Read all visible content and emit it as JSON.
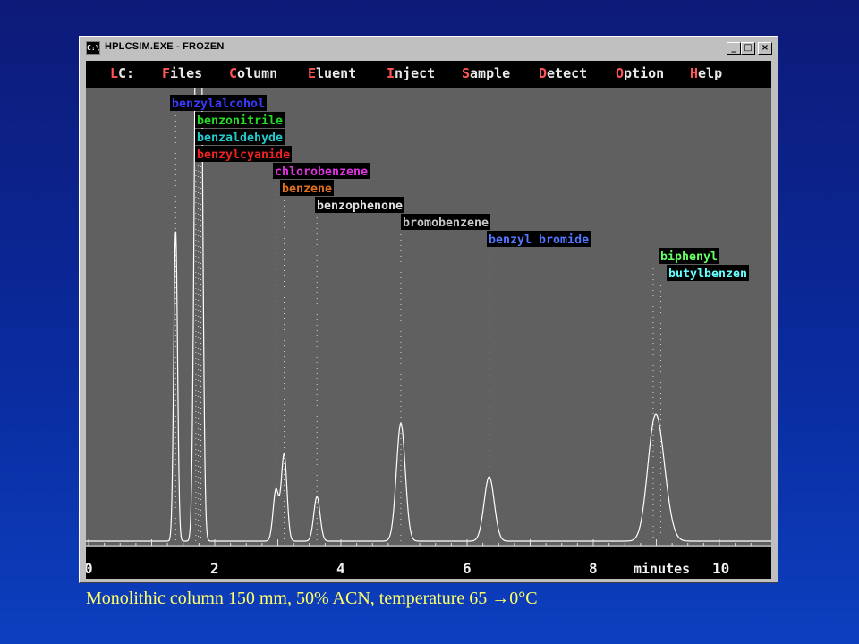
{
  "window": {
    "title": "HPLCSIM.EXE - FROZEN",
    "icon_text": "C:\\",
    "buttons": {
      "minimize": "_",
      "maximize": "□",
      "close": "×"
    }
  },
  "menu": [
    {
      "hot": "L",
      "rest": "C:"
    },
    {
      "hot": "F",
      "rest": "iles"
    },
    {
      "hot": "C",
      "rest": "olumn"
    },
    {
      "hot": "E",
      "rest": "luent"
    },
    {
      "hot": "I",
      "rest": "nject"
    },
    {
      "hot": "S",
      "rest": "ample"
    },
    {
      "hot": "D",
      "rest": "etect"
    },
    {
      "hot": "O",
      "rest": "ption"
    },
    {
      "hot": "H",
      "rest": "elp"
    }
  ],
  "chart_data": {
    "type": "line",
    "xlabel": "minutes",
    "xlim": [
      0,
      10.7
    ],
    "xticks": [
      0,
      2,
      4,
      6,
      8,
      10
    ],
    "peaks": [
      {
        "name": "benzylalcohol",
        "rt": 1.38,
        "height": 0.7,
        "width": 0.03,
        "label_color": "#3a3aff"
      },
      {
        "name": "benzonitrile",
        "rt": 1.7,
        "height": 0.82,
        "width": 0.035,
        "label_color": "#22dd22"
      },
      {
        "name": "benzaldehyde",
        "rt": 1.74,
        "height": 0.86,
        "width": 0.035,
        "label_color": "#22cccc"
      },
      {
        "name": "benzylcyanide",
        "rt": 1.78,
        "height": 0.92,
        "width": 0.035,
        "label_color": "#ee2222"
      },
      {
        "name": "chlorobenzene",
        "rt": 2.97,
        "height": 0.115,
        "width": 0.045,
        "label_color": "#dd33dd"
      },
      {
        "name": "benzene",
        "rt": 3.1,
        "height": 0.195,
        "width": 0.045,
        "label_color": "#e07020"
      },
      {
        "name": "benzophenone",
        "rt": 3.62,
        "height": 0.1,
        "width": 0.05,
        "label_color": "#e0e0e0"
      },
      {
        "name": "bromobenzene",
        "rt": 4.95,
        "height": 0.265,
        "width": 0.07,
        "label_color": "#c8c8c8"
      },
      {
        "name": "benzyl bromide",
        "rt": 6.35,
        "height": 0.145,
        "width": 0.08,
        "label_color": "#5577ff"
      },
      {
        "name": "biphenyl",
        "rt": 8.95,
        "height": 0.185,
        "width": 0.11,
        "label_color": "#66ff66"
      },
      {
        "name": "butylbenzen",
        "rt": 9.07,
        "height": 0.14,
        "width": 0.12,
        "label_color": "#66ffff"
      }
    ],
    "background": "#606060",
    "trace_color": "#ffffff"
  },
  "caption": {
    "before": "Monolithic column 150 mm, 50% ACN, temperature 65 ",
    "arrow": "→",
    "after": "0°C"
  }
}
